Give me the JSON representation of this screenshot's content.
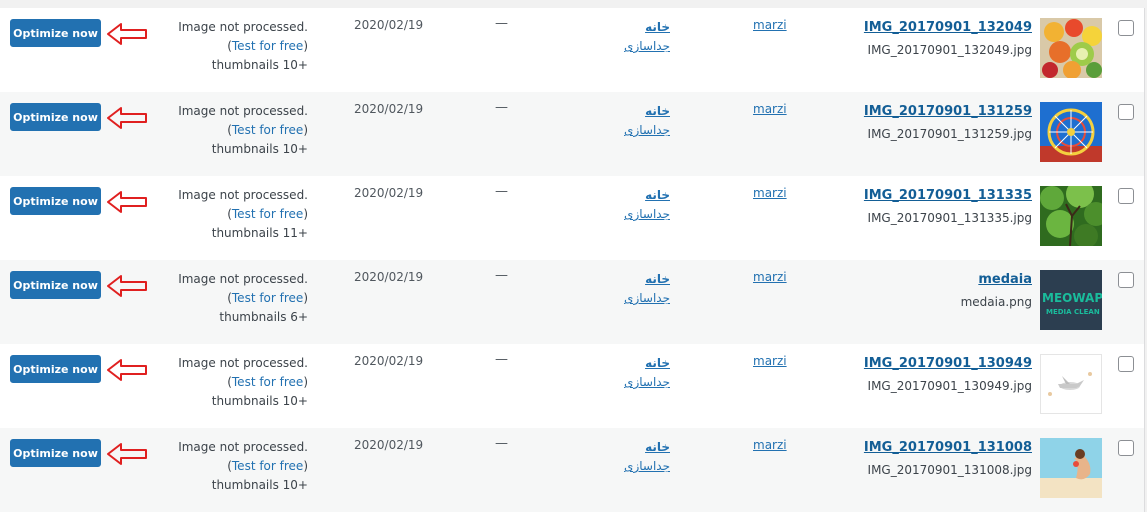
{
  "rows": [
    {
      "optimize_label": "Optimize now",
      "status_line1": "Image not processed.",
      "status_paren_open": "(",
      "test_link": "Test for free",
      "status_paren_close": ")",
      "thumbnails": "thumbnails 10+",
      "date": "2020/02/19",
      "comments": "—",
      "parent": "خانه",
      "detach": "جداسازی",
      "author": "marzi",
      "title": "IMG_20170901_132049",
      "filename": "IMG_20170901_132049.jpg",
      "thumb_icon": "fruit-photo"
    },
    {
      "optimize_label": "Optimize now",
      "status_line1": "Image not processed.",
      "status_paren_open": "(",
      "test_link": "Test for free",
      "status_paren_close": ")",
      "thumbnails": "thumbnails 10+",
      "date": "2020/02/19",
      "comments": "—",
      "parent": "خانه",
      "detach": "جداسازی",
      "author": "marzi",
      "title": "IMG_20170901_131259",
      "filename": "IMG_20170901_131259.jpg",
      "thumb_icon": "ferris-wheel-photo"
    },
    {
      "optimize_label": "Optimize now",
      "status_line1": "Image not processed.",
      "status_paren_open": "(",
      "test_link": "Test for free",
      "status_paren_close": ")",
      "thumbnails": "thumbnails 11+",
      "date": "2020/02/19",
      "comments": "—",
      "parent": "خانه",
      "detach": "جداسازی",
      "author": "marzi",
      "title": "IMG_20170901_131335",
      "filename": "IMG_20170901_131335.jpg",
      "thumb_icon": "tree-photo"
    },
    {
      "optimize_label": "Optimize now",
      "status_line1": "Image not processed.",
      "status_paren_open": "(",
      "test_link": "Test for free",
      "status_paren_close": ")",
      "thumbnails": "thumbnails 6+",
      "date": "2020/02/19",
      "comments": "—",
      "parent": "خانه",
      "detach": "جداسازی",
      "author": "marzi",
      "title": "medaia",
      "filename": "medaia.png",
      "thumb_icon": "meowapps-logo",
      "thumb_text1": "MEOWAP",
      "thumb_text2": "MEDIA CLEAN"
    },
    {
      "optimize_label": "Optimize now",
      "status_line1": "Image not processed.",
      "status_paren_open": "(",
      "test_link": "Test for free",
      "status_paren_close": ")",
      "thumbnails": "thumbnails 10+",
      "date": "2020/02/19",
      "comments": "—",
      "parent": "خانه",
      "detach": "جداسازی",
      "author": "marzi",
      "title": "IMG_20170901_130949",
      "filename": "IMG_20170901_130949.jpg",
      "thumb_icon": "airplane-photo"
    },
    {
      "optimize_label": "Optimize now",
      "status_line1": "Image not processed.",
      "status_paren_open": "(",
      "test_link": "Test for free",
      "status_paren_close": ")",
      "thumbnails": "thumbnails 10+",
      "date": "2020/02/19",
      "comments": "—",
      "parent": "خانه",
      "detach": "جداسازی",
      "author": "marzi",
      "title": "IMG_20170901_131008",
      "filename": "IMG_20170901_131008.jpg",
      "thumb_icon": "beach-photo"
    }
  ],
  "colors": {
    "button": "#2271b1",
    "link": "#2271b1",
    "arrow": "#e02020",
    "row_odd": "#ffffff",
    "row_even": "#f6f7f7"
  }
}
